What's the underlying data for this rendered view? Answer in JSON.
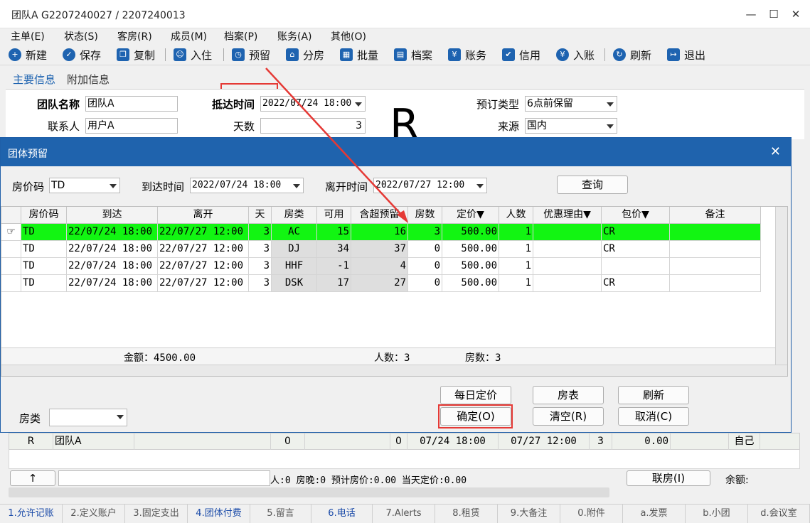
{
  "window": {
    "title": "团队A  G2207240027  /  2207240013",
    "minimize": "—",
    "maximize": "☐",
    "close": "✕"
  },
  "menu": [
    "主单(E)",
    "状态(S)",
    "客房(R)",
    "成员(M)",
    "档案(P)",
    "账务(A)",
    "其他(O)"
  ],
  "toolbar": {
    "new": "新建",
    "save": "保存",
    "copy": "复制",
    "checkin": "入住",
    "reserve": "预留",
    "assign": "分房",
    "batch": "批量",
    "profile": "档案",
    "account": "账务",
    "credit": "信用",
    "post": "入账",
    "refresh": "刷新",
    "exit": "退出"
  },
  "tabs": {
    "main": "主要信息",
    "extra": "附加信息"
  },
  "form": {
    "group_name_label": "团队名称",
    "group_name": "团队A",
    "contact_label": "联系人",
    "contact": "用户A",
    "arrival_label": "抵达时间",
    "arrival": "2022/07/24 18:00",
    "days_label": "天数",
    "days": "3",
    "booking_type_label": "预订类型",
    "booking_type": "6点前保留",
    "source_label": "来源",
    "source": "国内",
    "status_letter": "R"
  },
  "dialog": {
    "title": "团体预留",
    "close": "✕",
    "rate_code_label": "房价码",
    "rate_code": "TD",
    "arrive_label": "到达时间",
    "arrive": "2022/07/24 18:00",
    "depart_label": "离开时间",
    "depart": "2022/07/27 12:00",
    "query": "查询",
    "columns": [
      "房价码",
      "到达",
      "离开",
      "天",
      "房类",
      "可用",
      "含超预留",
      "房数",
      "定价▼",
      "人数",
      "优惠理由▼",
      "包价▼",
      "备注"
    ],
    "rows": [
      {
        "code": "TD",
        "arrive": "22/07/24 18:00",
        "depart": "22/07/27 12:00",
        "days": "3",
        "type": "AC",
        "avail": "15",
        "over": "16",
        "rooms": "3",
        "price": "500.00",
        "persons": "1",
        "reason": "",
        "package": "CR",
        "note": ""
      },
      {
        "code": "TD",
        "arrive": "22/07/24 18:00",
        "depart": "22/07/27 12:00",
        "days": "3",
        "type": "DJ",
        "avail": "34",
        "over": "37",
        "rooms": "0",
        "price": "500.00",
        "persons": "1",
        "reason": "",
        "package": "CR",
        "note": ""
      },
      {
        "code": "TD",
        "arrive": "22/07/24 18:00",
        "depart": "22/07/27 12:00",
        "days": "3",
        "type": "HHF",
        "avail": "-1",
        "over": "4",
        "rooms": "0",
        "price": "500.00",
        "persons": "1",
        "reason": "",
        "package": "",
        "note": ""
      },
      {
        "code": "TD",
        "arrive": "22/07/24 18:00",
        "depart": "22/07/27 12:00",
        "days": "3",
        "type": "DSK",
        "avail": "17",
        "over": "27",
        "rooms": "0",
        "price": "500.00",
        "persons": "1",
        "reason": "",
        "package": "CR",
        "note": ""
      }
    ],
    "summary": {
      "amount": "金额：4500.00",
      "persons": "人数：3",
      "rooms": "房数：3"
    },
    "room_type_label": "房类",
    "buttons": {
      "daily_price": "每日定价",
      "room_chart": "房表",
      "refresh": "刷新",
      "confirm": "确定(O)",
      "clear": "清空(R)",
      "cancel": "取消(C)"
    }
  },
  "lower_row": {
    "status": "R",
    "name": "团队A",
    "c1": "0",
    "c2": "0",
    "arrive": "07/24 18:00",
    "depart": "07/27 12:00",
    "days": "3",
    "amount": "0.00",
    "by": "自己"
  },
  "status_line": {
    "up": "↑",
    "text": "人:0  房晚:0  预计房价:0.00  当天定价:0.00",
    "linked_room": "联房(I)",
    "balance": "余额:"
  },
  "bottom_tabs": [
    "1.允许记账",
    "2.定义账户",
    "3.固定支出",
    "4.团体付费",
    "5.留言",
    "6.电话",
    "7.Alerts",
    "8.租赁",
    "9.大备注",
    "0.附件",
    "a.发票",
    "b.小团",
    "d.会议室"
  ],
  "colors": {
    "title_bar": "#1f63ad",
    "highlight_row": "#12f512",
    "annotation": "#e53935",
    "accent": "#1e63b0"
  }
}
